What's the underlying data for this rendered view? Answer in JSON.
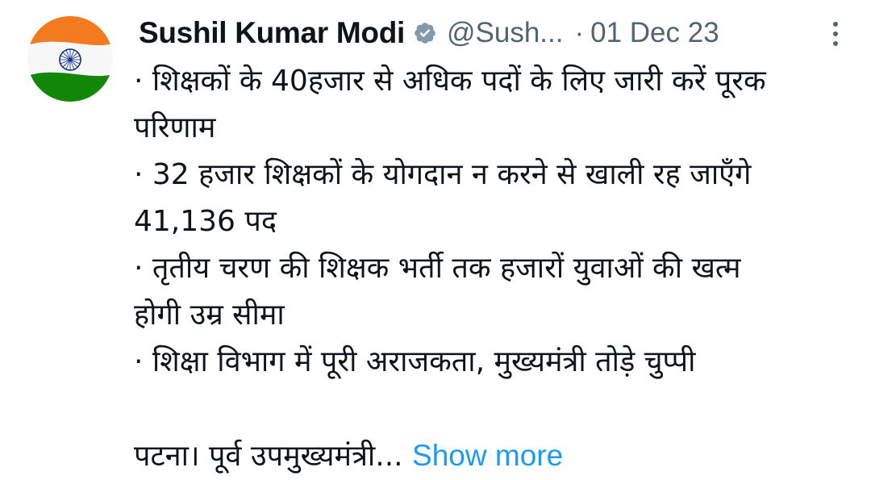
{
  "author": {
    "display_name": "Sushil Kumar Modi",
    "handle": "@Sush...",
    "separator": "·",
    "date": "01 Dec 23",
    "avatar_icon": "indian-flag-avatar",
    "verified_icon": "verified-badge-icon",
    "verified_color": "#829aab"
  },
  "menu": {
    "icon": "more-vertical-icon"
  },
  "tweet": {
    "lines": [
      "· शिक्षकों के 40हजार से अधिक पदों के लिए जारी करें पूरक",
      "परिणाम",
      "· 32 हजार शिक्षकों के योगदान न करने से खाली रह जाएँगे",
      "41,136 पद",
      "· तृतीय चरण की शिक्षक भर्ती तक हजारों युवाओं की खत्म",
      "होगी उम्र सीमा",
      "· शिक्षा विभाग में पूरी अराजकता, मुख्यमंत्री तोड़े चुप्पी"
    ],
    "last_line": "पटना। पूर्व उपमुख्यमंत्री...",
    "show_more": "Show more"
  },
  "colors": {
    "text": "#0f1419",
    "secondary": "#536471",
    "link": "#1d9bf0",
    "flag_saffron": "#f47a1f",
    "flag_green": "#138808",
    "chakra": "#0b2f8a"
  }
}
